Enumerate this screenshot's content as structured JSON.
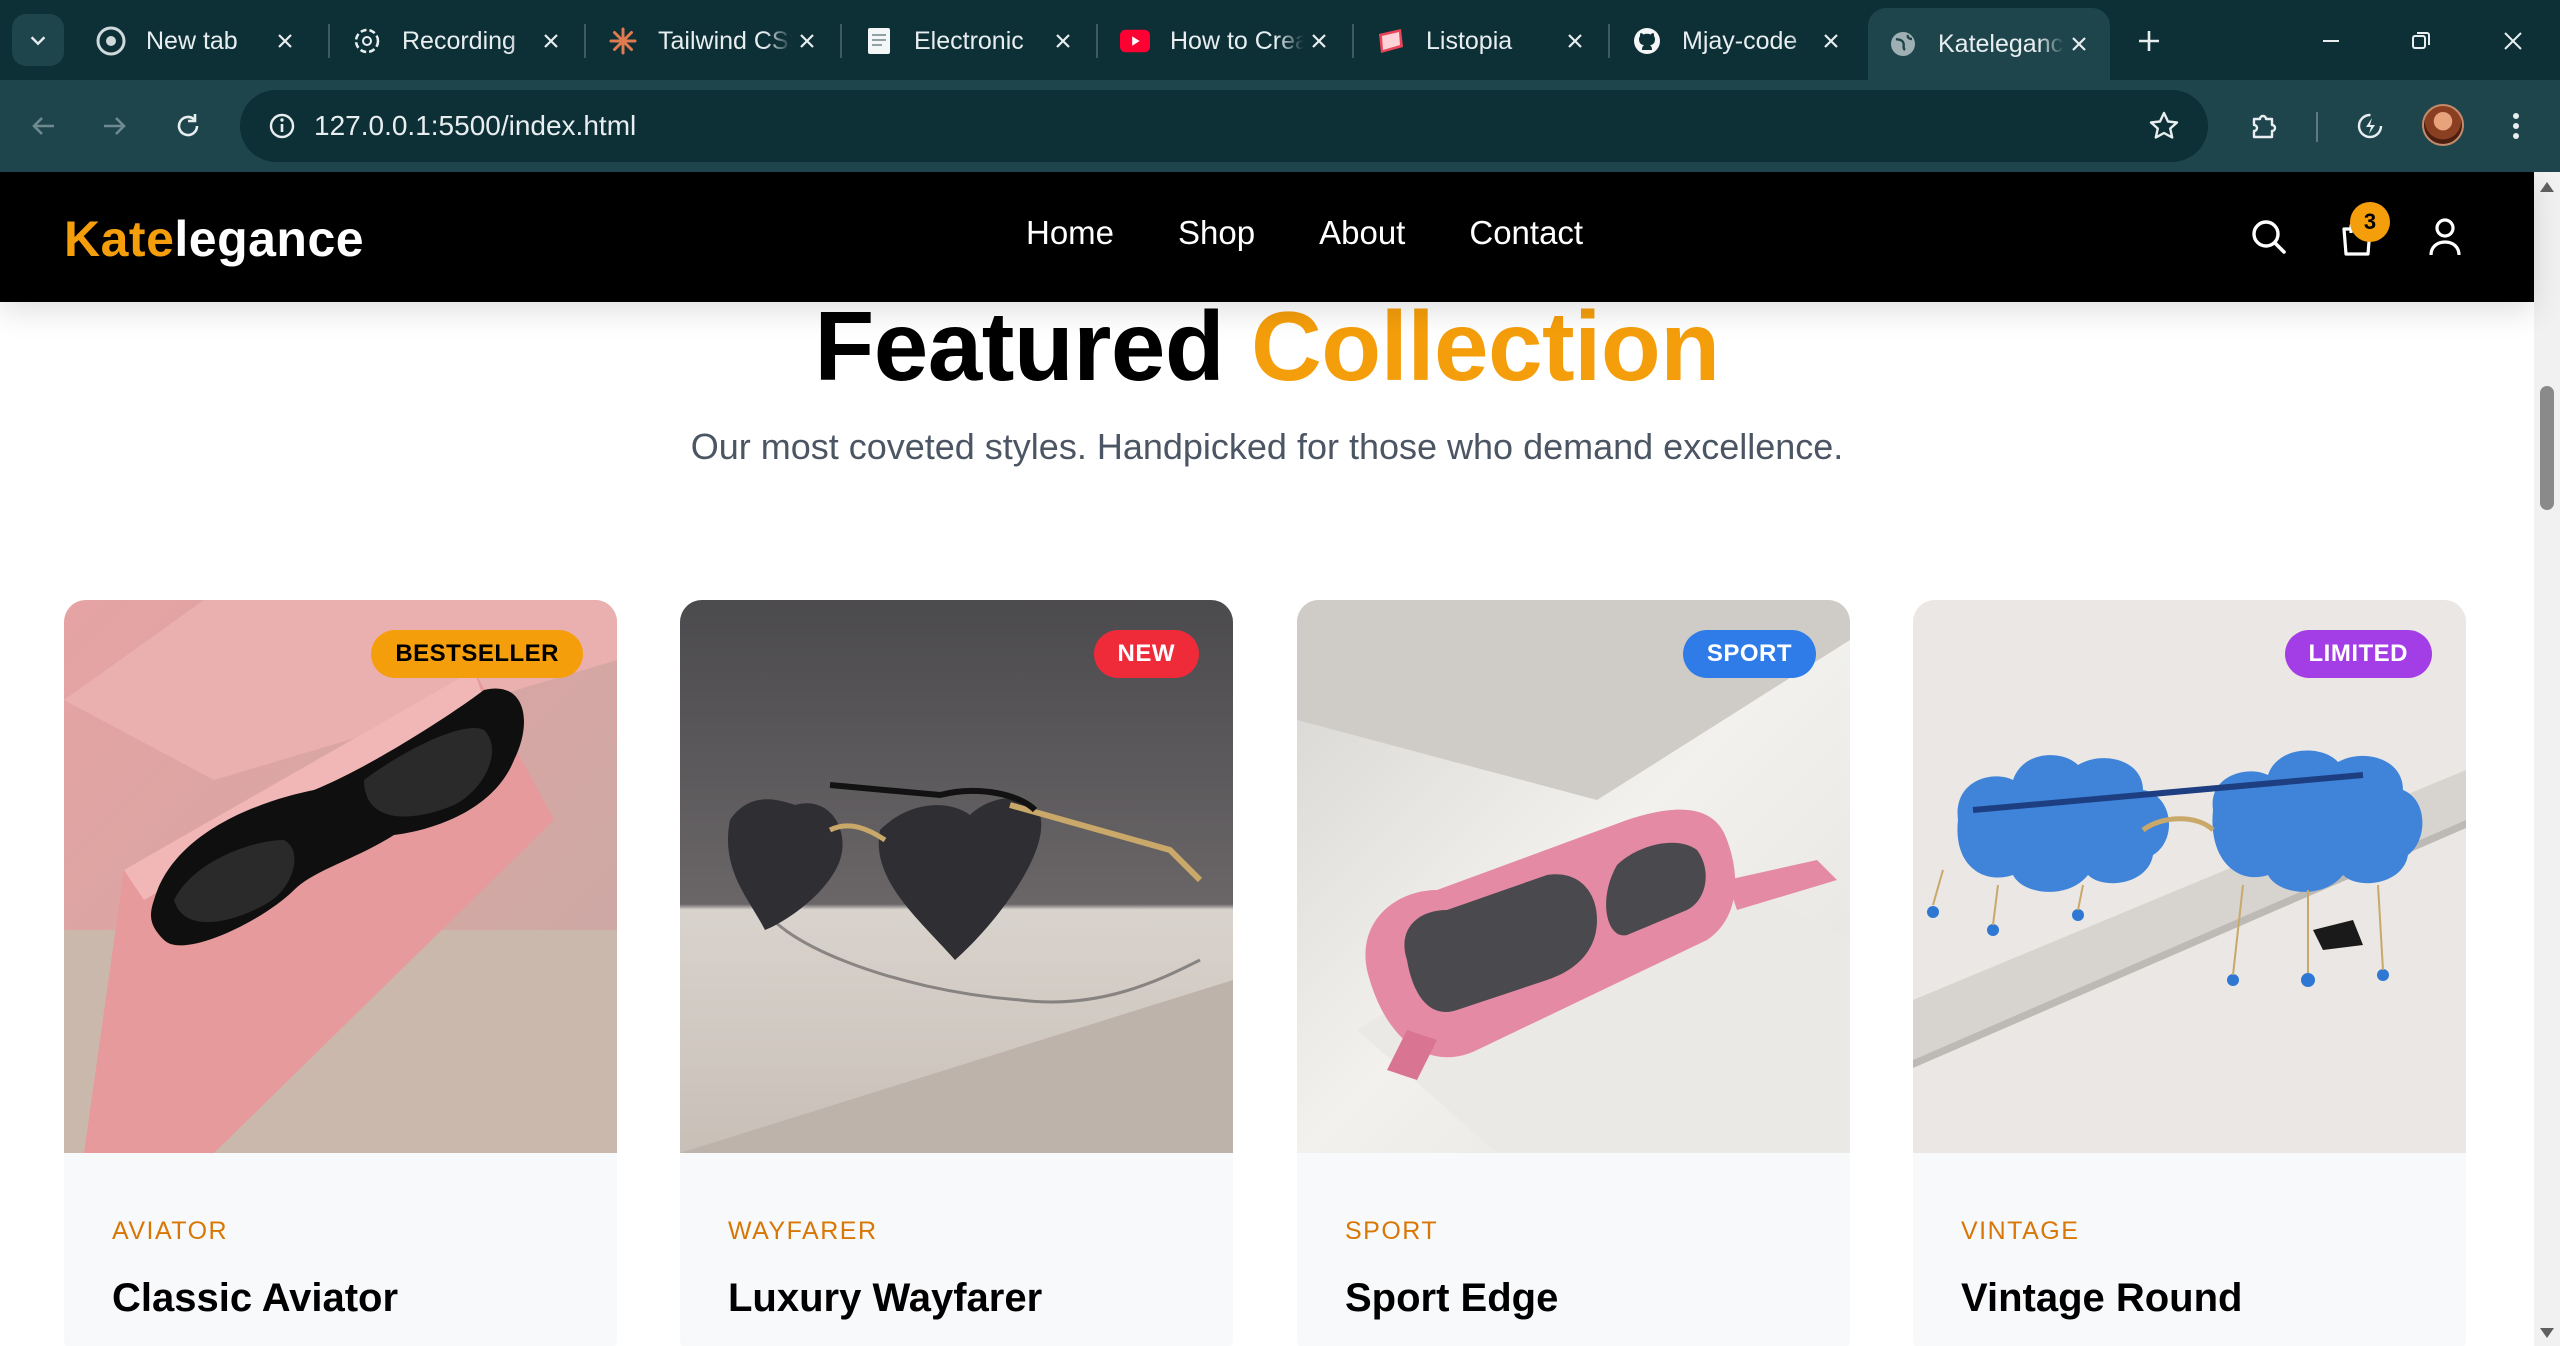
{
  "browser": {
    "tabs": [
      {
        "title": "New tab",
        "icon": "chrome-icon"
      },
      {
        "title": "Recording",
        "icon": "chatgpt-icon"
      },
      {
        "title": "Tailwind CSS",
        "icon": "claude-icon"
      },
      {
        "title": "Electronic",
        "icon": "document-icon"
      },
      {
        "title": "How to Create",
        "icon": "youtube-icon"
      },
      {
        "title": "Listopia",
        "icon": "listopia-icon"
      },
      {
        "title": "Mjay-code",
        "icon": "github-icon"
      },
      {
        "title": "Katelegance",
        "icon": "globe-icon",
        "active": true
      }
    ],
    "url": "127.0.0.1:5500/index.html"
  },
  "header": {
    "logo_a": "Kate",
    "logo_b": "legance",
    "nav": [
      "Home",
      "Shop",
      "About",
      "Contact"
    ],
    "cart_count": "3"
  },
  "section": {
    "title_a": "Featured",
    "title_b": "Collection",
    "subtitle": "Our most coveted styles. Handpicked for those who demand excellence."
  },
  "products": [
    {
      "badge": "BESTSELLER",
      "badge_color": "#f59e0b",
      "badge_text_color": "#000000",
      "category": "AVIATOR",
      "name": "Classic Aviator"
    },
    {
      "badge": "NEW",
      "badge_color": "#ef2b3a",
      "badge_text_color": "#ffffff",
      "category": "WAYFARER",
      "name": "Luxury Wayfarer"
    },
    {
      "badge": "SPORT",
      "badge_color": "#2f7be8",
      "badge_text_color": "#ffffff",
      "category": "SPORT",
      "name": "Sport Edge"
    },
    {
      "badge": "LIMITED",
      "badge_color": "#a33de6",
      "badge_text_color": "#ffffff",
      "category": "VINTAGE",
      "name": "Vintage Round"
    }
  ],
  "colors": {
    "accent": "#f59e0b",
    "header_bg": "#000000",
    "chrome_dark": "#0d2f36",
    "chrome_mid": "#1f454c"
  }
}
